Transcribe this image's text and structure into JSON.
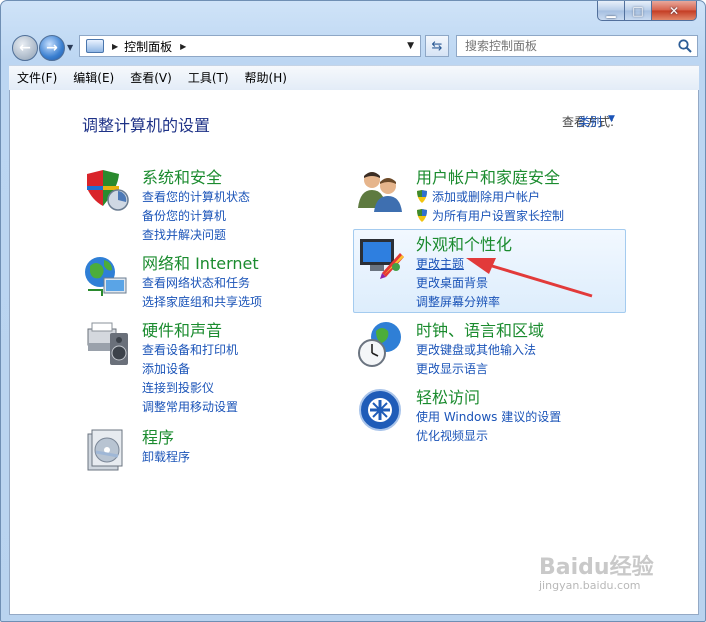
{
  "window": {
    "title_buttons": {
      "minimize": "minimize-icon",
      "maximize": "maximize-icon",
      "close": "close-icon"
    }
  },
  "address_bar": {
    "path": "控制面板",
    "icon": "control-panel-icon"
  },
  "search": {
    "placeholder": "搜索控制面板",
    "icon": "search-icon"
  },
  "menu": [
    "文件(F)",
    "编辑(E)",
    "查看(V)",
    "工具(T)",
    "帮助(H)"
  ],
  "header": {
    "title": "调整计算机的设置",
    "view_by_label": "查看方式:",
    "view_by_value": "类别"
  },
  "categories": [
    {
      "title": "系统和安全",
      "icon": "system-security-icon",
      "links": [
        "查看您的计算机状态",
        "备份您的计算机",
        "查找并解决问题"
      ]
    },
    {
      "title": "网络和 Internet",
      "icon": "network-icon",
      "links": [
        "查看网络状态和任务",
        "选择家庭组和共享选项"
      ]
    },
    {
      "title": "硬件和声音",
      "icon": "hardware-sound-icon",
      "links": [
        "查看设备和打印机",
        "添加设备",
        "连接到投影仪",
        "调整常用移动设置"
      ]
    },
    {
      "title": "程序",
      "icon": "programs-icon",
      "links": [
        "卸载程序"
      ]
    },
    {
      "title": "用户帐户和家庭安全",
      "icon": "user-accounts-icon",
      "links": [
        "添加或删除用户帐户",
        "为所有用户设置家长控制"
      ]
    },
    {
      "title": "外观和个性化",
      "icon": "appearance-icon",
      "links": [
        "更改主题",
        "更改桌面背景",
        "调整屏幕分辨率"
      ]
    },
    {
      "title": "时钟、语言和区域",
      "icon": "clock-globe-icon",
      "links": [
        "更改键盘或其他输入法",
        "更改显示语言"
      ]
    },
    {
      "title": "轻松访问",
      "icon": "ease-of-access-icon",
      "links": [
        "使用 Windows 建议的设置",
        "优化视频显示"
      ]
    }
  ],
  "colors": {
    "category_title": "#1a8b2e",
    "link": "#1b54b8",
    "page_title": "#1e3287",
    "annotation_arrow": "#e23a3a"
  },
  "watermark": {
    "brand": "Baidu经验",
    "url": "jingyan.baidu.com"
  }
}
